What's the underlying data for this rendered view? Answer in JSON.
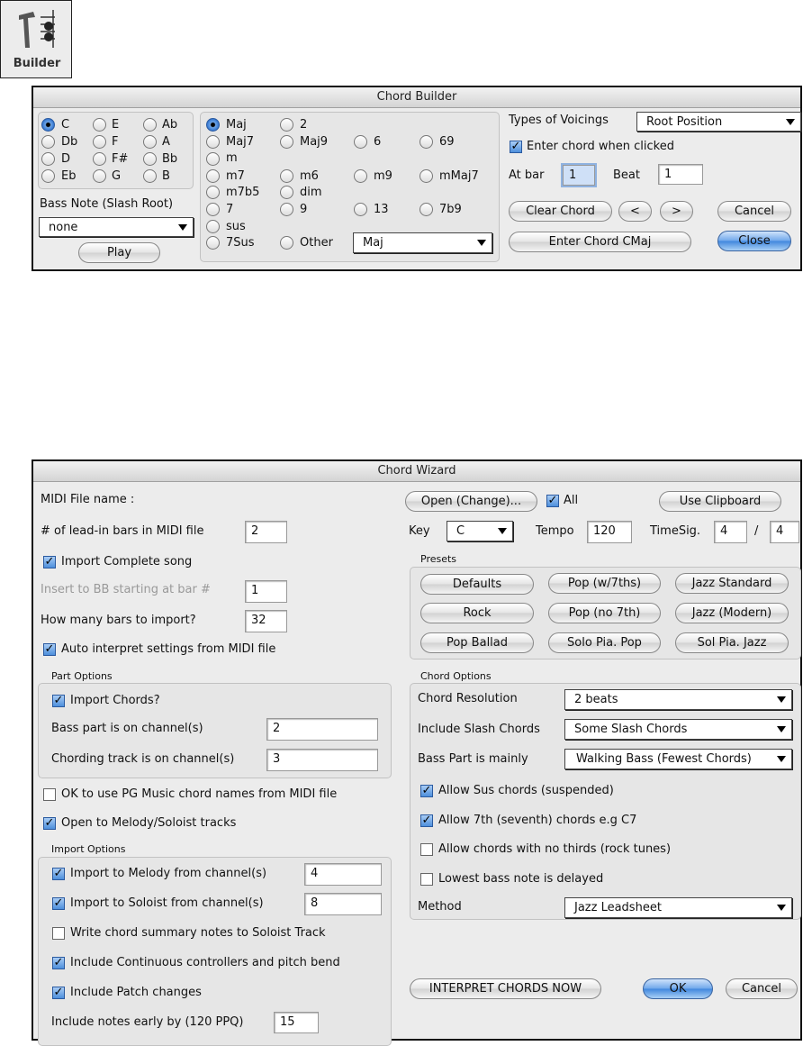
{
  "toolbar_icon": {
    "label": "Builder"
  },
  "chord_builder": {
    "title": "Chord Builder",
    "roots": [
      "C",
      "Db",
      "D",
      "Eb",
      "E",
      "F",
      "F#",
      "G",
      "Ab",
      "A",
      "Bb",
      "B"
    ],
    "selected_root": "C",
    "bass_note_label": "Bass Note (Slash Root)",
    "bass_note_value": "none",
    "play": "Play",
    "types": {
      "maj": "Maj",
      "two": "2",
      "maj7": "Maj7",
      "maj9": "Maj9",
      "six": "6",
      "sixnine": "69",
      "m": "m",
      "m7": "m7",
      "m6": "m6",
      "m9": "m9",
      "mmaj7": "mMaj7",
      "m7b5": "m7b5",
      "dim": "dim",
      "seven": "7",
      "nine": "9",
      "thirteen": "13",
      "sevenb9": "7b9",
      "sus": "sus",
      "sevensus": "7Sus",
      "other": "Other"
    },
    "selected_type": "Maj",
    "other_value": "Maj",
    "voicings_label": "Types of Voicings",
    "voicings_value": "Root Position",
    "enter_when_clicked": "Enter chord when clicked",
    "at_bar_label": "At bar",
    "at_bar": "1",
    "beat_label": "Beat",
    "beat": "1",
    "clear": "Clear Chord",
    "prev": "<",
    "next": ">",
    "cancel": "Cancel",
    "enter": "Enter Chord CMaj",
    "close": "Close"
  },
  "chord_wizard": {
    "title": "Chord Wizard",
    "midi_file_label": "MIDI File name :",
    "leadin_label": "# of lead-in bars in MIDI file",
    "leadin": "2",
    "import_complete": "Import Complete song",
    "insert_label": "Insert to BB starting at bar #",
    "insert": "1",
    "bars_label": "How many bars to import?",
    "bars": "32",
    "auto_interpret": "Auto interpret settings from MIDI file",
    "part_options": "Part Options",
    "import_chords": "Import Chords?",
    "bass_channel_label": "Bass part is on channel(s)",
    "bass_channel": "2",
    "chording_label": "Chording track is on channel(s)",
    "chording": "3",
    "pg_names": "OK to use PG Music chord names from MIDI file",
    "open_melody": "Open to Melody/Soloist tracks",
    "import_options": "Import Options",
    "melody_label": "Import to Melody from channel(s)",
    "melody": "4",
    "soloist_label": "Import to Soloist from channel(s)",
    "soloist": "8",
    "summary": "Write chord summary notes to Soloist Track",
    "controllers": "Include Continuous controllers and pitch bend",
    "patch": "Include Patch changes",
    "early_label": "Include notes early by (120 PPQ)",
    "early": "15",
    "open": "Open (Change)...",
    "all": "All",
    "clipboard": "Use Clipboard",
    "key_label": "Key",
    "key": "C",
    "tempo_label": "Tempo",
    "tempo": "120",
    "timesig_label": "TimeSig.",
    "ts_num": "4",
    "slash": "/",
    "ts_den": "4",
    "presets_label": "Presets",
    "presets": [
      "Defaults",
      "Pop (w/7ths)",
      "Jazz Standard",
      "Rock",
      "Pop (no 7th)",
      "Jazz (Modern)",
      "Pop Ballad",
      "Solo Pia. Pop",
      "Sol Pia. Jazz"
    ],
    "chord_options": "Chord Options",
    "resolution_label": "Chord Resolution",
    "resolution": "2 beats",
    "slash_label": "Include Slash Chords",
    "slash_value": "Some Slash Chords",
    "bass_mainly_label": "Bass Part is mainly",
    "bass_mainly": "Walking Bass (Fewest Chords)",
    "allow_sus": "Allow Sus chords (suspended)",
    "allow_7th": "Allow 7th (seventh) chords e.g C7",
    "no_thirds": "Allow chords with no thirds (rock tunes)",
    "lowest_bass": "Lowest bass note is delayed",
    "method_label": "Method",
    "method": "Jazz Leadsheet",
    "interpret": "INTERPRET CHORDS NOW",
    "ok": "OK",
    "cancel": "Cancel"
  }
}
